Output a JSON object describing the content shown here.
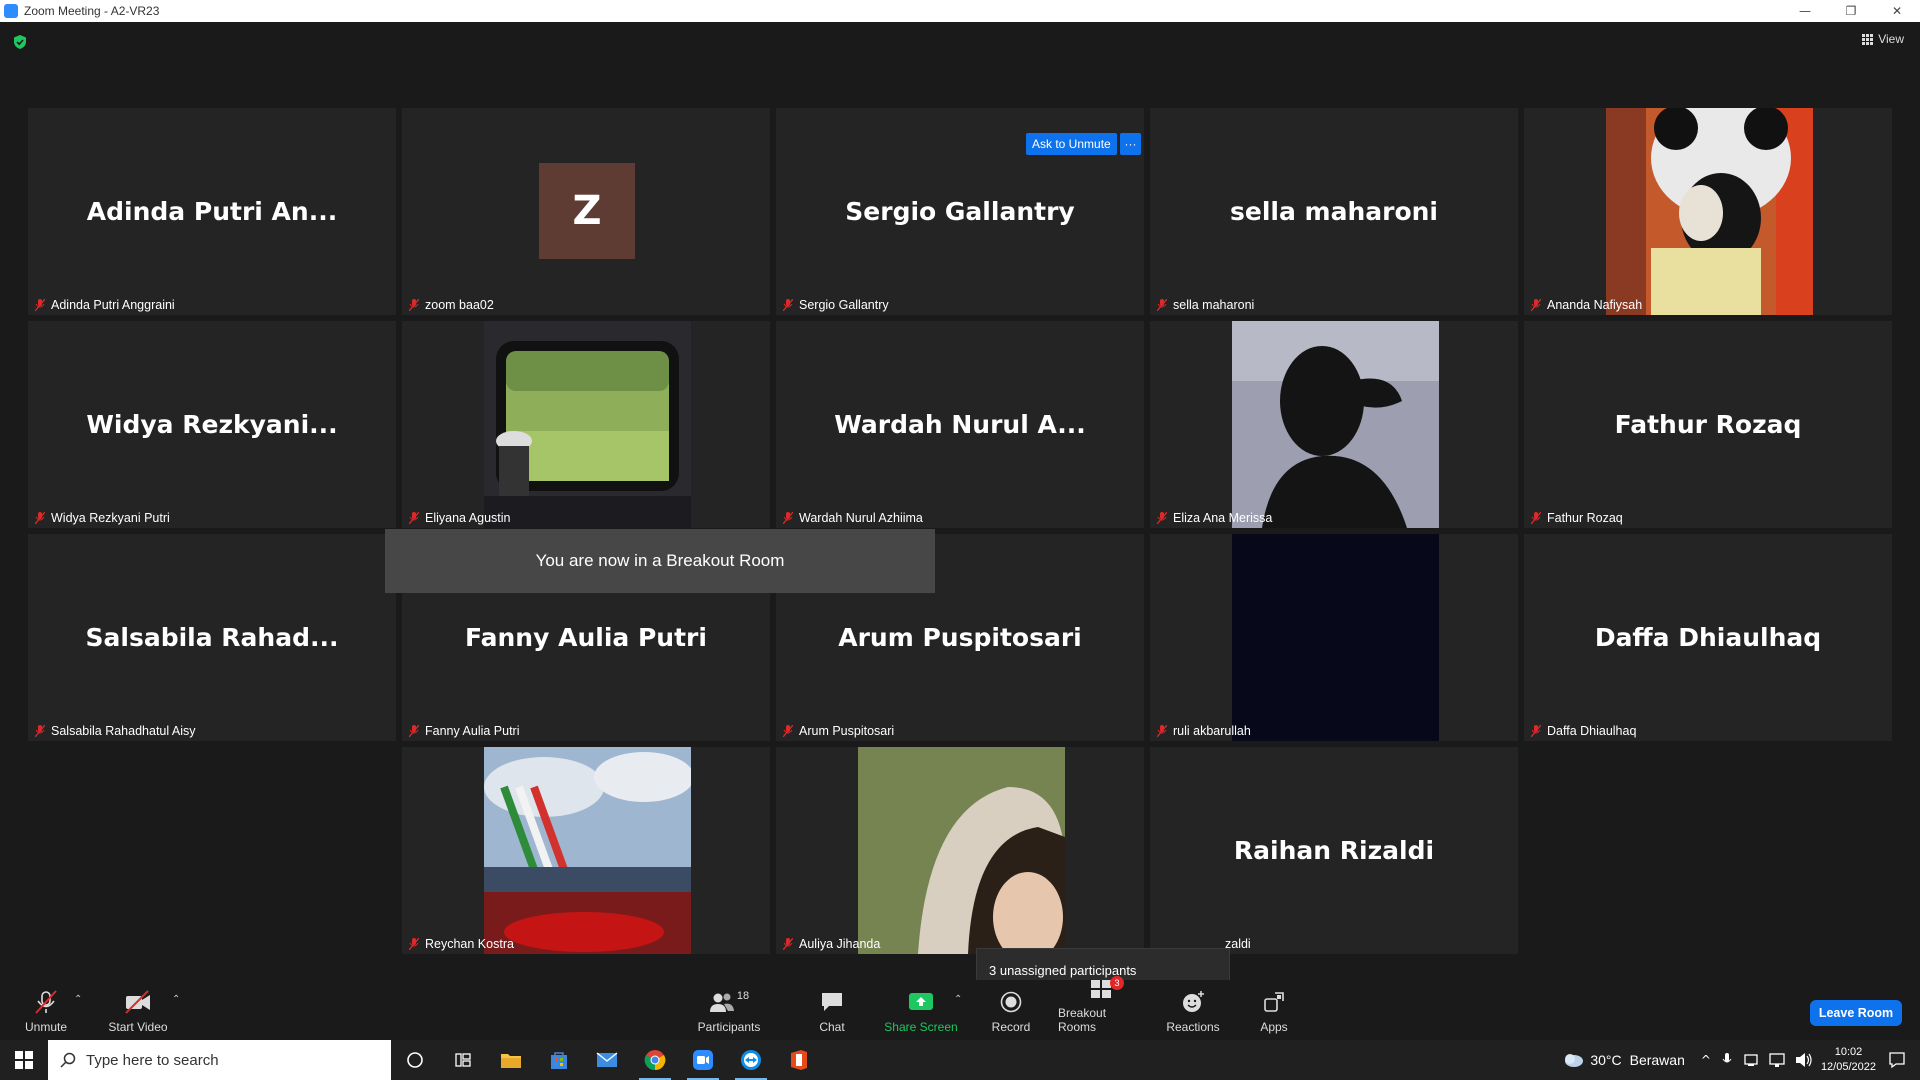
{
  "window": {
    "title": "Zoom Meeting - A2-VR23",
    "minimize": "—",
    "restore": "❐",
    "close": "✕"
  },
  "meeting": {
    "view_label": "View",
    "ask_to_unmute": "Ask to Unmute",
    "more_options": "···",
    "toast": "You are now in a Breakout Room",
    "unassigned_tip": "3 unassigned participants",
    "tiles": [
      {
        "display": "Adinda Putri An...",
        "name": "Adinda Putri Anggraini"
      },
      {
        "display": "Z",
        "name": "zoom baa02"
      },
      {
        "display": "Sergio Gallantry",
        "name": "Sergio Gallantry"
      },
      {
        "display": "sella maharoni",
        "name": "sella maharoni"
      },
      {
        "display": "",
        "name": "Ananda Nafiysah"
      },
      {
        "display": "Widya  Rezkyani...",
        "name": "Widya Rezkyani Putri"
      },
      {
        "display": "",
        "name": "Eliyana Agustin"
      },
      {
        "display": "Wardah Nurul A...",
        "name": "Wardah Nurul Azhiima"
      },
      {
        "display": "",
        "name": "Eliza Ana Merissa"
      },
      {
        "display": "Fathur Rozaq",
        "name": "Fathur Rozaq"
      },
      {
        "display": "Salsabila  Rahad...",
        "name": "Salsabila Rahadhatul Aisy"
      },
      {
        "display": "Fanny Aulia Putri",
        "name": "Fanny Aulia Putri"
      },
      {
        "display": "Arum Puspitosari",
        "name": "Arum Puspitosari"
      },
      {
        "display": "",
        "name": "ruli akbarullah"
      },
      {
        "display": "Daffa Dhiaulhaq",
        "name": "Daffa Dhiaulhaq"
      },
      {
        "display": "",
        "name": "Reychan Kostra"
      },
      {
        "display": "",
        "name": "Auliya Jihanda"
      },
      {
        "display": "Raihan Rizaldi",
        "name": "zaldi"
      }
    ]
  },
  "toolbar": {
    "unmute": "Unmute",
    "start_video": "Start Video",
    "participants": "Participants",
    "participants_count": "18",
    "chat": "Chat",
    "share_screen": "Share Screen",
    "record": "Record",
    "breakout_rooms": "Breakout Rooms",
    "breakout_badge": "3",
    "reactions": "Reactions",
    "apps": "Apps",
    "leave_room": "Leave Room",
    "caret": "⌃"
  },
  "taskbar": {
    "search_placeholder": "Type here to search",
    "weather_temp": "30°C",
    "weather_desc": "Berawan",
    "time": "10:02",
    "date": "12/05/2022"
  },
  "colors": {
    "accent": "#0e72ed",
    "share_green": "#1ec760",
    "mute_red": "#e02828",
    "badge_red": "#e02828"
  }
}
